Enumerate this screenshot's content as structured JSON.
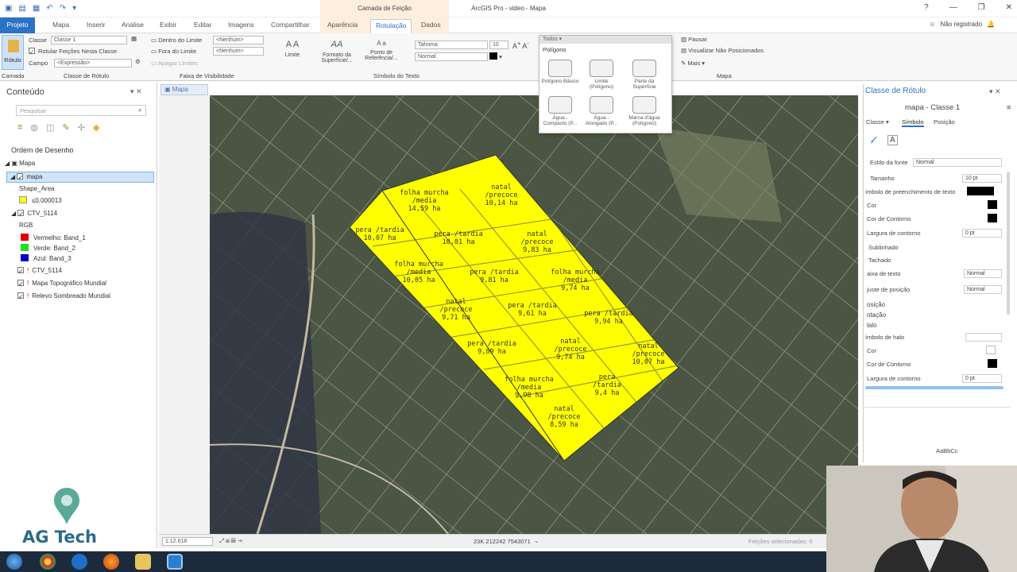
{
  "app": {
    "title": "ArcGIS Pro - video - Mapa",
    "contextual_group": "Camada de Feição",
    "user": "Não registrado"
  },
  "tabs": [
    "Projeto",
    "Mapa",
    "Inserir",
    "Análise",
    "Exibir",
    "Editar",
    "Imagens",
    "Compartilhar",
    "Aparência",
    "Rotulação",
    "Dados"
  ],
  "ribbon": {
    "rotulo_button": "Rótulo",
    "classe_label": "Classe",
    "classe_value": "Classe 1",
    "rotular_checkbox": "Rotular Feições Nesta Classe",
    "campo_label": "Campo",
    "campo_value": "<Expressão>",
    "group_camada": "Camada",
    "group_classe": "Classe de Rótulo",
    "dentro_limite": "Dentro do Limite",
    "fora_limite": "Fora do Limite",
    "apagar_limites": "Apagar Limites",
    "nenhum_1": "<Nenhum>",
    "nenhum_2": "<Nenhum>",
    "group_faixa": "Faixa de Visibilidade",
    "limite_btn": "Limite",
    "formato_btn": "Formato da Superfície/...",
    "ponto_btn": "Ponto de Referência/...",
    "font_name": "Tahoma",
    "font_size": "10",
    "font_style": "Normal",
    "group_simbolo": "Símbolo do Texto",
    "pausar": "Pausar",
    "visualizar": "Visualizar Não Posicionados",
    "mais": "Mais",
    "group_mapa": "Mapa"
  },
  "gallery": {
    "header": "Todos",
    "category": "Polígono",
    "items": [
      {
        "label": "Polígono Básico"
      },
      {
        "label": "Limite (Polígono)"
      },
      {
        "label": "Parte da Superfície"
      },
      {
        "label": "Água - Compacto (P..."
      },
      {
        "label": "Água - Alongado (P..."
      },
      {
        "label": "Marca d'água (Polígono)"
      }
    ]
  },
  "contents": {
    "title": "Conteúdo",
    "search_placeholder": "Pesquisar",
    "drawing_order": "Ordem de Desenho",
    "map_node": "Mapa",
    "layer_mapa": "mapa",
    "shape_area": "Shape_Area",
    "shape_value": "≤0,000013",
    "ctv1": "CTV_5114",
    "rgb": "RGB",
    "band_red": "Vermelho: Band_1",
    "band_green": "Verde: Band_2",
    "band_blue": "Azul: Band_3",
    "ctv2": "CTV_5114",
    "topo": "Mapa Topográfico Mundial",
    "relevo": "Relevo Sombreado Mundial"
  },
  "map": {
    "tab": "Mapa",
    "scale": "1:12.618",
    "coords": "23K 212242 7543071",
    "selected": "Feições selecionadas: 0",
    "labels": [
      {
        "text": "folha murcha\n/media\n14,59 ha"
      },
      {
        "text": "natal\n/precoce\n10,14 ha"
      },
      {
        "text": "pera /tardia\n10,07 ha"
      },
      {
        "text": "pera /tardia\n10,01 ha"
      },
      {
        "text": "natal\n/precoce\n9,83 ha"
      },
      {
        "text": "folha murcha\n/media\n10,05 ha"
      },
      {
        "text": "pera /tardia\n9,81 ha"
      },
      {
        "text": "folha murcha\n/media\n9,74 ha"
      },
      {
        "text": "natal\n/precoce\n9,71 ha"
      },
      {
        "text": "pera /tardia\n9,61 ha"
      },
      {
        "text": "pera /tardia\n9,94 ha"
      },
      {
        "text": "pera /tardia\n9,89 ha"
      },
      {
        "text": "natal\n/precoce\n9,74 ha"
      },
      {
        "text": "natal\n/precoce\n10,07 ha"
      },
      {
        "text": "folha murcha\n/media\n9,98 ha"
      },
      {
        "text": "pera\n/tardia\n9,4 ha"
      },
      {
        "text": "natal\n/precoce\n8,59 ha"
      }
    ]
  },
  "label_class_pane": {
    "title": "Classe de Rótulo",
    "subtitle": "mapa - Classe 1",
    "tab_classe": "Classe",
    "tab_simbolo": "Símbolo",
    "tab_posicao": "Posição",
    "estilo_label": "Estilo da fonte",
    "estilo_value": "Normal",
    "tamanho_label": "Tamanho",
    "tamanho_value": "10 pt",
    "preench_label": "ímbolo de preenchimento de texto",
    "cor_label": "Cor",
    "cor_contorno_label": "Cor de Contorno",
    "largura_label": "Largura de contorno",
    "largura_value": "0 pt",
    "sublinhado": "Sublinhado",
    "tachado": "Tachado",
    "caixa_label": "aixa de texto",
    "caixa_value": "Normal",
    "ajuste_label": "juste de posição",
    "ajuste_value": "Normal",
    "posicao": "osição",
    "rotacao": "otação",
    "halo": "lalo",
    "simbolo_halo": "ímbolo de halo",
    "cor2_label": "Cor",
    "cor_contorno2_label": "Cor de Contorno",
    "largura2_label": "Largura de contorno",
    "largura2_value": "0 pt",
    "preview_text": "AaBbCc"
  },
  "logo": {
    "name": "AG Tech"
  },
  "colors": {
    "accent": "#2b73c6",
    "polygon_fill": "#ffff00",
    "band_red": "#e00000",
    "band_green": "#22dd22",
    "band_blue": "#0000cc"
  }
}
